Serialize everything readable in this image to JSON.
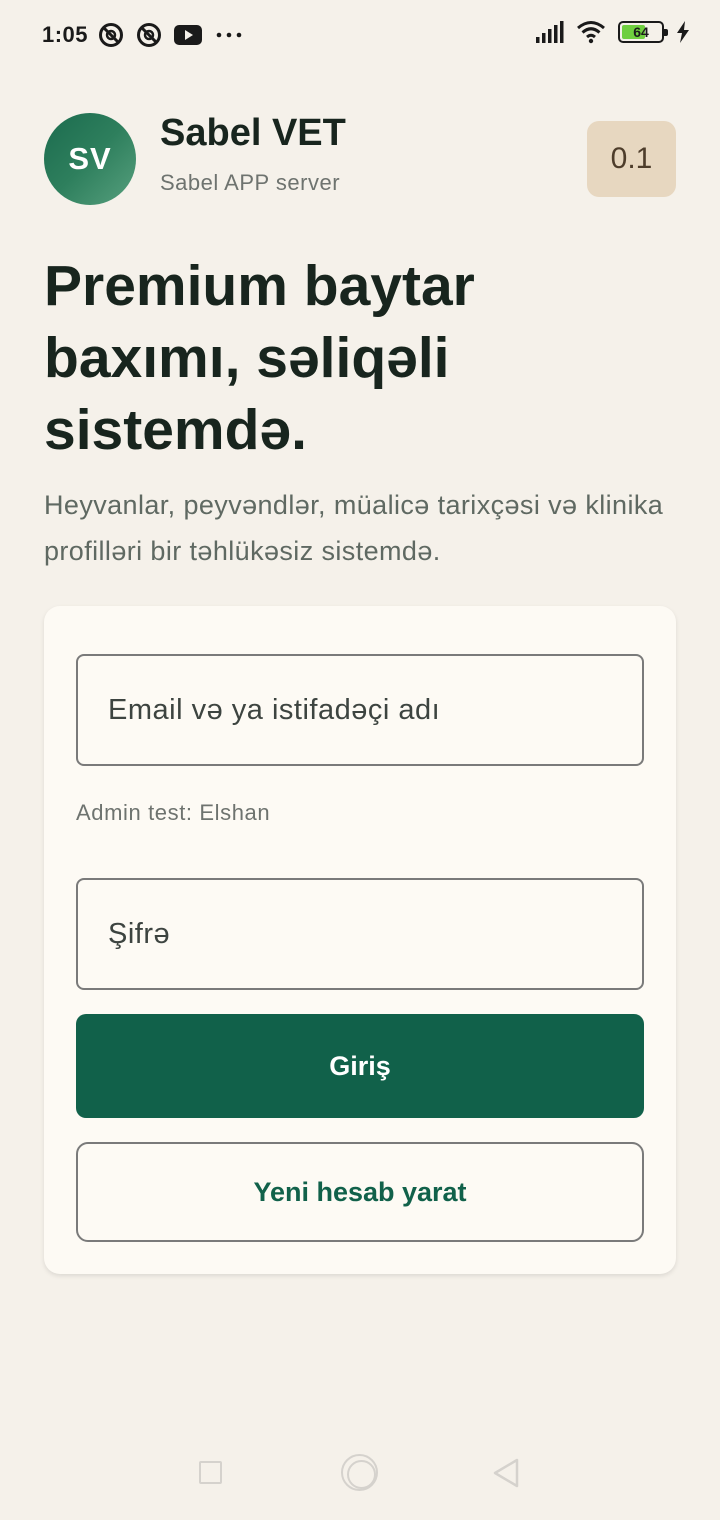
{
  "status_bar": {
    "time": "1:05",
    "battery_level": "64",
    "battery_percent": 64,
    "left_icons": [
      "vpn-shield-icon",
      "vpn-shield-icon",
      "youtube-icon",
      "more-dots-icon"
    ],
    "right_icons": [
      "signal-icon",
      "wifi-icon",
      "battery-icon",
      "charging-bolt-icon"
    ]
  },
  "header": {
    "avatar_initials": "SV",
    "title": "Sabel VET",
    "subtitle": "Sabel APP server",
    "version": "0.1"
  },
  "hero": {
    "title": "Premium baytar baxımı, səliqəli sistemdə.",
    "description": "Heyvanlar, peyvəndlər, müalicə tarixçəsi və klinika profilləri bir təhlükəsiz sistemdə."
  },
  "login_form": {
    "username_placeholder": "Email və ya istifadəçi adı",
    "admin_hint": "Admin test: Elshan",
    "password_placeholder": "Şifrə",
    "login_label": "Giriş",
    "register_label": "Yeni hesab yarat"
  },
  "colors": {
    "background": "#f5f1ea",
    "card": "#fdfaf4",
    "primary": "#11614a",
    "version_badge": "#e7d7c0",
    "battery_fill": "#6fcf3f"
  }
}
